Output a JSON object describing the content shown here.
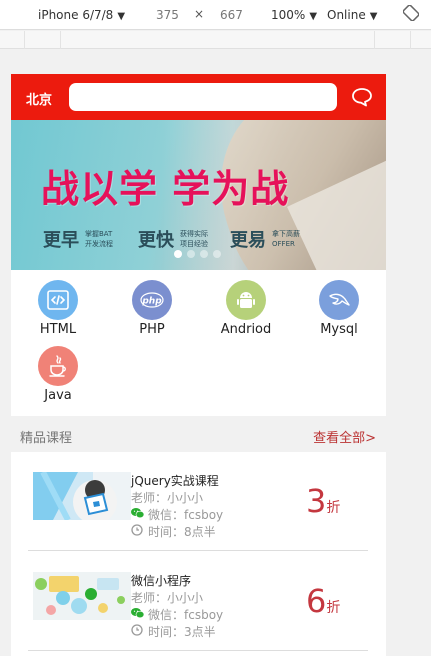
{
  "devtools": {
    "device": "iPhone 6/7/8",
    "width": "375",
    "times": "×",
    "height": "667",
    "zoom": "100%",
    "network": "Online"
  },
  "header": {
    "city": "北京",
    "search_placeholder": "",
    "brand_color": "#ec1b0e"
  },
  "banner": {
    "title": "战以学 学为战",
    "slogans": [
      {
        "big": "更早",
        "small1": "掌握BAT",
        "small2": "开发流程"
      },
      {
        "big": "更快",
        "small1": "获得实际",
        "small2": "项目经验"
      },
      {
        "big": "更易",
        "small1": "拿下高薪",
        "small2": "OFFER"
      }
    ],
    "active_slide": 1,
    "slide_count": 4
  },
  "categories": [
    {
      "label": "HTML",
      "icon": "code-icon",
      "color": "#6fb6ef"
    },
    {
      "label": "PHP",
      "icon": "php-icon",
      "color": "#7b8fcf"
    },
    {
      "label": "Andriod",
      "icon": "android-icon",
      "color": "#b6d17a"
    },
    {
      "label": "Mysql",
      "icon": "mysql-dolphin-icon",
      "color": "#7b9fdc"
    },
    {
      "label": "Java",
      "icon": "java-cup-icon",
      "color": "#f08277"
    }
  ],
  "section": {
    "title": "精品课程",
    "more": "查看全部>"
  },
  "courses": [
    {
      "name": "jQuery实战课程",
      "teacher": "老师：小小小",
      "wechat": "微信：fcsboy",
      "time": "时间：8点半",
      "discount": "3",
      "unit": "折"
    },
    {
      "name": "微信小程序",
      "teacher": "老师：小小小",
      "wechat": "微信：fcsboy",
      "time": "时间：3点半",
      "discount": "6",
      "unit": "折"
    }
  ]
}
